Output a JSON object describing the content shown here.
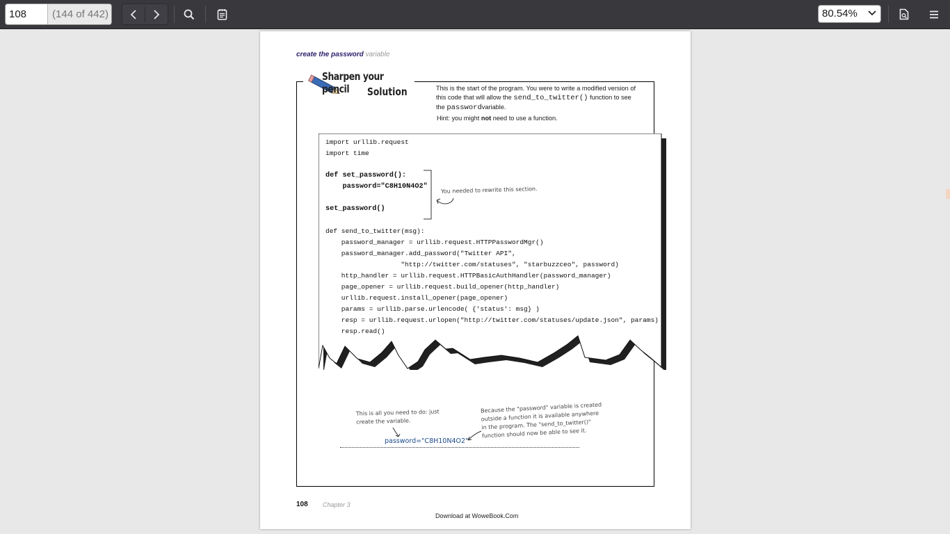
{
  "toolbar": {
    "page_number": "108",
    "page_count": "(144 of 442)",
    "zoom": "80.54%"
  },
  "icons": {
    "prev": "chevron-left-icon",
    "next": "chevron-right-icon",
    "search": "search-icon",
    "annotations": "notes-icon",
    "document_properties": "document-icon",
    "menu": "hamburger-menu-icon"
  },
  "page": {
    "header_bold": "create the password",
    "header_light": "variable",
    "logo_line1": "Sharpen your pencil",
    "logo_line2": "Solution",
    "intro_1": "This is the start of the program. You were to write a modified version of this code that will allow the",
    "intro_code1": "send_to_twitter()",
    "intro_2": "function to see the",
    "intro_code2": "password",
    "intro_3": "variable.",
    "hint_pre": "Hint: you might",
    "hint_bold": "not",
    "hint_post": "need to use a function.",
    "code": {
      "l1": "import urllib.request",
      "l2": "import time",
      "l3": "def set_password():",
      "l4": "    password=\"C8H10N4O2\"",
      "l5": "set_password()",
      "l6": "def send_to_twitter(msg):",
      "l7": "    password_manager = urllib.request.HTTPPasswordMgr()",
      "l8": "    password_manager.add_password(\"Twitter API\",",
      "l9": "                   \"http://twitter.com/statuses\", \"starbuzzceo\", password)",
      "l10": "    http_handler = urllib.request.HTTPBasicAuthHandler(password_manager)",
      "l11": "    page_opener = urllib.request.build_opener(http_handler)",
      "l12": "    urllib.request.install_opener(page_opener)",
      "l13": "    params = urllib.parse.urlencode( {'status': msg} )",
      "l14": "    resp = urllib.request.urlopen(\"http://twitter.com/statuses/update.json\", params)",
      "l15": "    resp.read()"
    },
    "note_rewrite": "You needed to rewrite this section.",
    "note_left_1": "This is all you need to do: just",
    "note_left_2": "create the variable.",
    "answer": "password=\"C8H10N4O2\"",
    "note_right_1": "Because the \"password\" variable is created",
    "note_right_2": "outside a function it is available anywhere",
    "note_right_3": "in the program. The \"send_to_twitter()\"",
    "note_right_4": "function should now be able to see it.",
    "footer_page": "108",
    "footer_chapter": "Chapter 3",
    "footer_download": "Download at WoweBook.Com"
  }
}
